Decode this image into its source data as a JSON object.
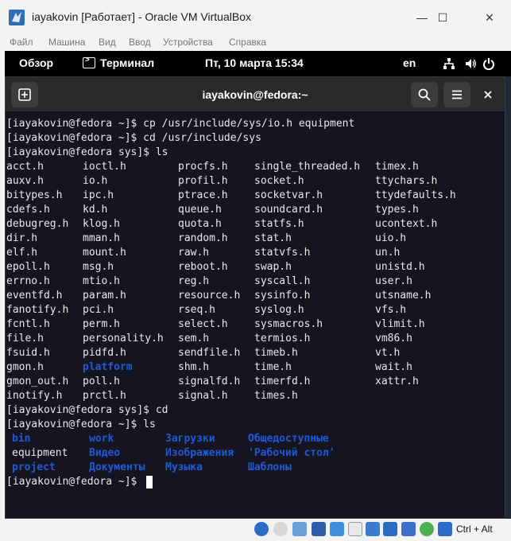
{
  "window": {
    "title": "iayakovin [Работает] - Oracle VM VirtualBox",
    "minimize": "—",
    "maximize": "☐",
    "close": "✕"
  },
  "menu": [
    "Файл",
    "Машина",
    "Вид",
    "Ввод",
    "Устройства",
    "Справка"
  ],
  "gnome": {
    "overview": "Обзор",
    "app": "Терминал",
    "clock": "Пт, 10 марта  15:34",
    "lang": "en"
  },
  "terminal": {
    "title": "iayakovin@fedora:~",
    "lines": [
      "[iayakovin@fedora ~]$ cp /usr/include/sys/io.h equipment",
      "[iayakovin@fedora ~]$ cd /usr/include/sys",
      "[iayakovin@fedora sys]$ ls"
    ],
    "ls_columns": [
      [
        "acct.h",
        "auxv.h",
        "bitypes.h",
        "cdefs.h",
        "debugreg.h",
        "dir.h",
        "elf.h",
        "epoll.h",
        "errno.h",
        "eventfd.h",
        "fanotify.h",
        "fcntl.h",
        "file.h",
        "fsuid.h",
        "gmon.h",
        "gmon_out.h",
        "inotify.h"
      ],
      [
        "ioctl.h",
        "io.h",
        "ipc.h",
        "kd.h",
        "klog.h",
        "mman.h",
        "mount.h",
        "msg.h",
        "mtio.h",
        "param.h",
        "pci.h",
        "perm.h",
        "personality.h",
        "pidfd.h",
        "platform",
        "poll.h",
        "prctl.h"
      ],
      [
        "procfs.h",
        "profil.h",
        "ptrace.h",
        "queue.h",
        "quota.h",
        "random.h",
        "raw.h",
        "reboot.h",
        "reg.h",
        "resource.h",
        "rseq.h",
        "select.h",
        "sem.h",
        "sendfile.h",
        "shm.h",
        "signalfd.h",
        "signal.h"
      ],
      [
        "single_threaded.h",
        "socket.h",
        "socketvar.h",
        "soundcard.h",
        "statfs.h",
        "stat.h",
        "statvfs.h",
        "swap.h",
        "syscall.h",
        "sysinfo.h",
        "syslog.h",
        "sysmacros.h",
        "termios.h",
        "timeb.h",
        "time.h",
        "timerfd.h",
        "times.h"
      ],
      [
        "timex.h",
        "ttychars.h",
        "ttydefaults.h",
        "types.h",
        "ucontext.h",
        "uio.h",
        "un.h",
        "unistd.h",
        "user.h",
        "utsname.h",
        "vfs.h",
        "vlimit.h",
        "vm86.h",
        "vt.h",
        "wait.h",
        "xattr.h",
        ""
      ]
    ],
    "after_lines": [
      "[iayakovin@fedora sys]$ cd",
      "[iayakovin@fedora ~]$ ls"
    ],
    "home_ls": [
      [
        "bin",
        "work",
        "Загрузки",
        "Общедоступные"
      ],
      [
        "equipment",
        "Видео",
        "Изображения",
        "'Рабочий стол'"
      ],
      [
        "project",
        "Документы",
        "Музыка",
        "Шаблоны"
      ]
    ],
    "home_ls_is_dir": [
      [
        true,
        true,
        true,
        true
      ],
      [
        false,
        true,
        true,
        true
      ],
      [
        true,
        true,
        true,
        true
      ]
    ],
    "prompt": "[iayakovin@fedora ~]$ "
  },
  "statusbar": {
    "host_key": "Ctrl + Alt"
  },
  "colors": {
    "terminal_bg": "#171421",
    "dir_blue": "#1e5bd4",
    "text": "#e8e8e8"
  }
}
